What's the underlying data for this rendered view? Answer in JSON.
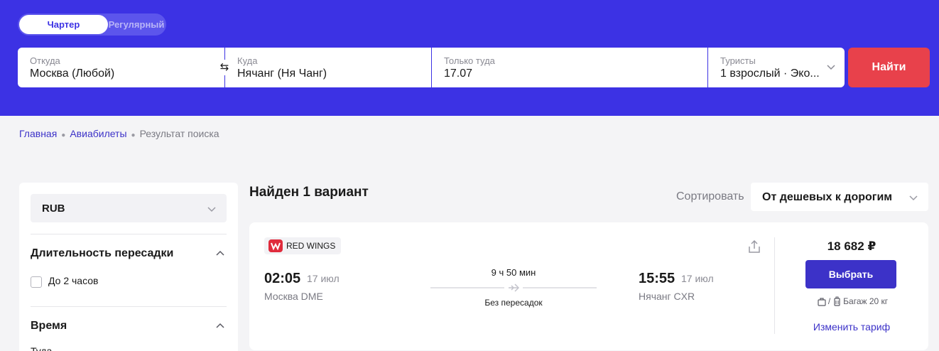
{
  "toggle": {
    "charter": "Чартер",
    "regular": "Регулярный"
  },
  "search": {
    "from": {
      "label": "Откуда",
      "value": "Москва (Любой)"
    },
    "to": {
      "label": "Куда",
      "value": "Нячанг (Ня Чанг)"
    },
    "date": {
      "label": "Только туда",
      "value": "17.07"
    },
    "tourists": {
      "label": "Туристы",
      "value": "1 взрослый · Эко..."
    },
    "swap_icon": "⇆",
    "find_label": "Найти"
  },
  "breadcrumb": {
    "home": "Главная",
    "tickets": "Авиабилеты",
    "current": "Результат поиска",
    "separator": "●"
  },
  "sidebar": {
    "currency": "RUB",
    "transfer_title": "Длительность пересадки",
    "transfer_option": "До 2 часов",
    "time_title": "Время",
    "time_sub": "Туда"
  },
  "results": {
    "title": "Найден 1 вариант",
    "sort_label": "Сортировать",
    "sort_value": "От дешевых к дорогим"
  },
  "flight": {
    "airline": "RED WINGS",
    "dep_time": "02:05",
    "dep_date": "17 июл",
    "dep_city": "Москва DME",
    "duration": "9 ч 50 мин",
    "stops": "Без пересадок",
    "arr_time": "15:55",
    "arr_date": "17 июл",
    "arr_city": "Нячанг CXR",
    "price": "18 682 ₽",
    "select_label": "Выбрать",
    "baggage_sep": "/",
    "baggage": "Багаж 20 кг",
    "change_tariff": "Изменить тариф"
  },
  "colors": {
    "brand": "#3c32e4",
    "accent_red": "#e8414b",
    "button": "#3c32c8"
  },
  "icons": [
    "swap-icon",
    "chevron-down-icon",
    "chevron-up-icon",
    "share-icon",
    "plane-icon",
    "bag-icon",
    "luggage-icon",
    "airline-logo-icon"
  ]
}
